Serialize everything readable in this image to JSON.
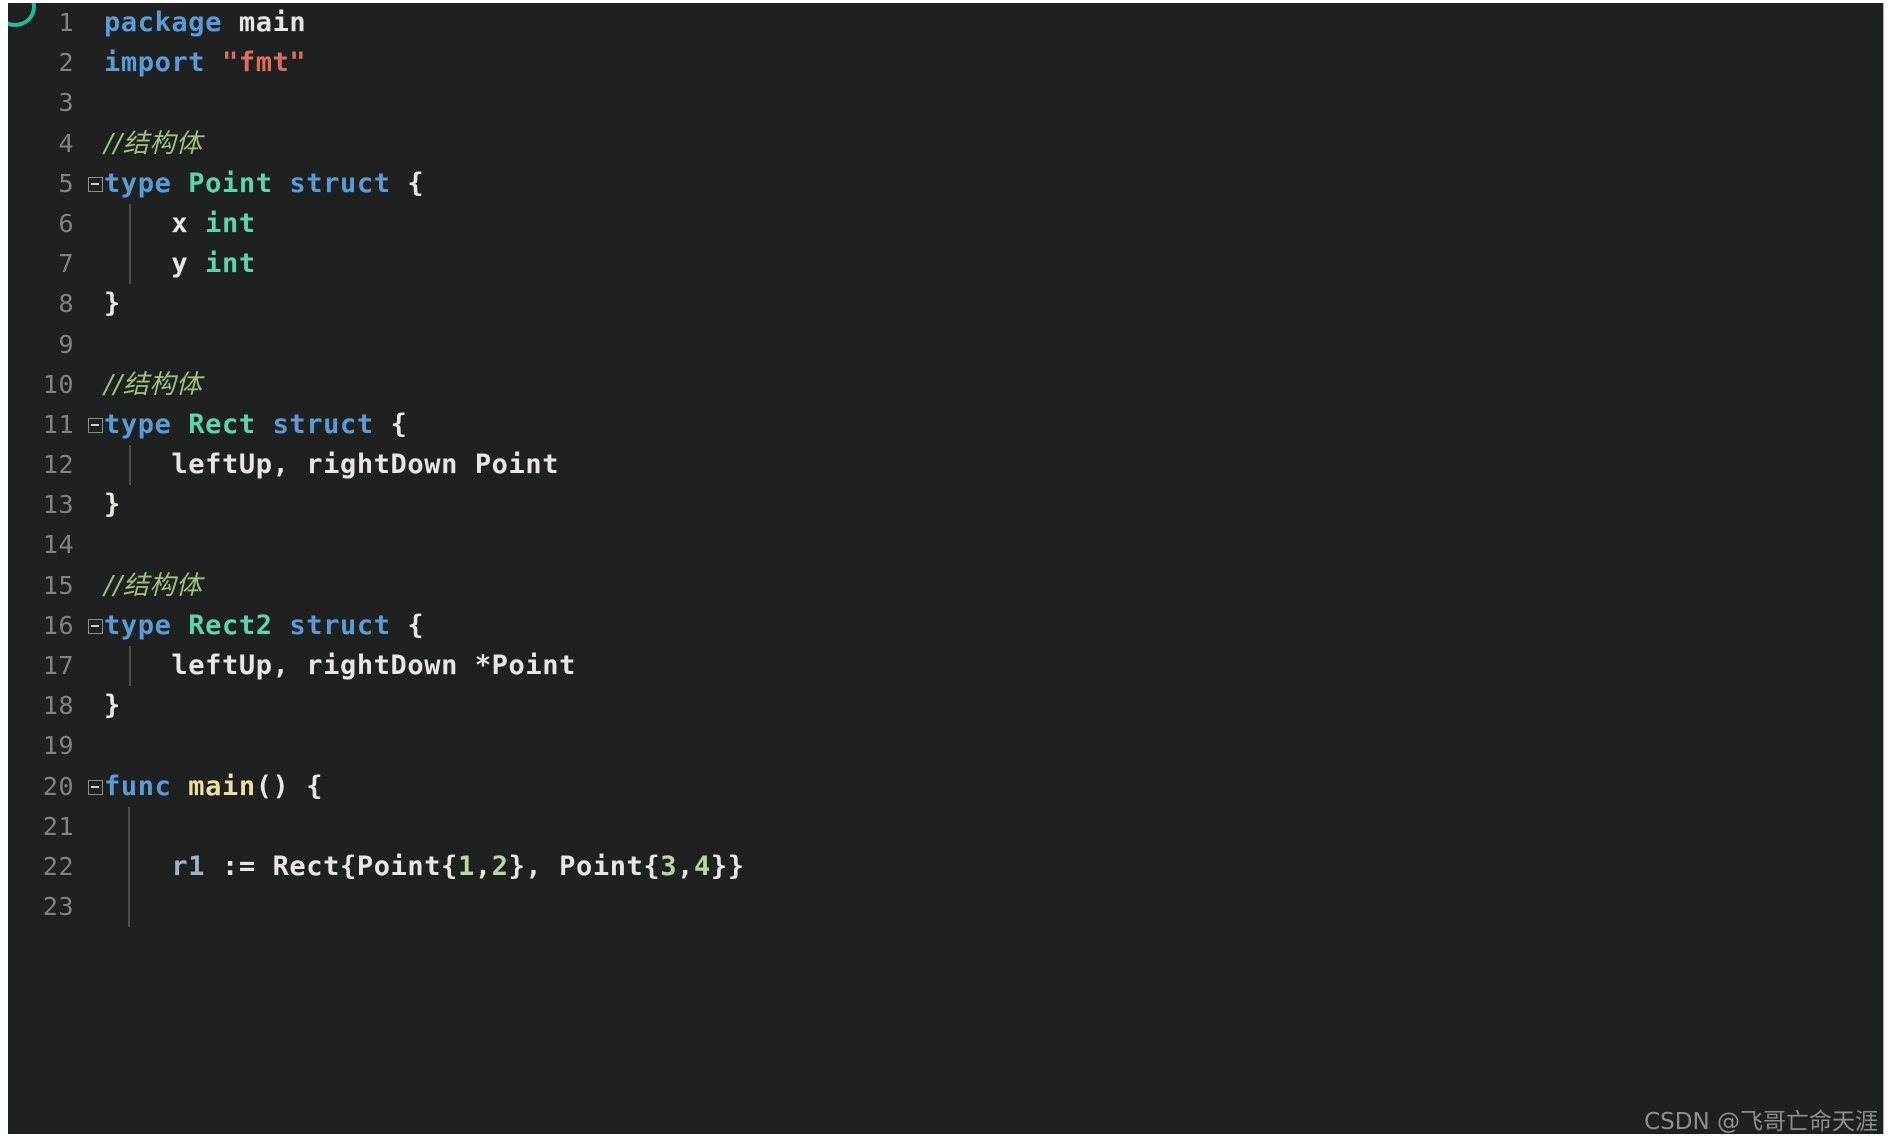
{
  "editor": {
    "language": "go",
    "background_color": "#1f2020",
    "gutter_text_color": "#7f8384",
    "fold_marker_glyph": "−",
    "lines": [
      {
        "number": "1",
        "folded": false,
        "indent_guide": false,
        "tokens": [
          {
            "text": "package",
            "type": "kw"
          },
          {
            "text": " ",
            "type": "plain"
          },
          {
            "text": "main",
            "type": "pkg"
          }
        ]
      },
      {
        "number": "2",
        "folded": false,
        "indent_guide": false,
        "tokens": [
          {
            "text": "import",
            "type": "kw"
          },
          {
            "text": " ",
            "type": "plain"
          },
          {
            "text": "\"fmt\"",
            "type": "str"
          }
        ]
      },
      {
        "number": "3",
        "folded": false,
        "indent_guide": false,
        "tokens": []
      },
      {
        "number": "4",
        "folded": false,
        "indent_guide": false,
        "tokens": [
          {
            "text": "//结构体",
            "type": "com"
          }
        ]
      },
      {
        "number": "5",
        "folded": true,
        "indent_guide": false,
        "tokens": [
          {
            "text": "type",
            "type": "kw"
          },
          {
            "text": " ",
            "type": "plain"
          },
          {
            "text": "Point",
            "type": "type"
          },
          {
            "text": " ",
            "type": "plain"
          },
          {
            "text": "struct",
            "type": "kw"
          },
          {
            "text": " ",
            "type": "plain"
          },
          {
            "text": "{",
            "type": "brace"
          }
        ]
      },
      {
        "number": "6",
        "folded": false,
        "indent_guide": true,
        "tokens": [
          {
            "text": "    x",
            "type": "plain"
          },
          {
            "text": " ",
            "type": "plain"
          },
          {
            "text": "int",
            "type": "type"
          }
        ]
      },
      {
        "number": "7",
        "folded": false,
        "indent_guide": true,
        "tokens": [
          {
            "text": "    y",
            "type": "plain"
          },
          {
            "text": " ",
            "type": "plain"
          },
          {
            "text": "int",
            "type": "type"
          }
        ]
      },
      {
        "number": "8",
        "folded": false,
        "indent_guide": false,
        "tokens": [
          {
            "text": "}",
            "type": "brace"
          }
        ]
      },
      {
        "number": "9",
        "folded": false,
        "indent_guide": false,
        "tokens": []
      },
      {
        "number": "10",
        "folded": false,
        "indent_guide": false,
        "tokens": [
          {
            "text": "//结构体",
            "type": "com"
          }
        ]
      },
      {
        "number": "11",
        "folded": true,
        "indent_guide": false,
        "tokens": [
          {
            "text": "type",
            "type": "kw"
          },
          {
            "text": " ",
            "type": "plain"
          },
          {
            "text": "Rect",
            "type": "type"
          },
          {
            "text": " ",
            "type": "plain"
          },
          {
            "text": "struct",
            "type": "kw"
          },
          {
            "text": " ",
            "type": "plain"
          },
          {
            "text": "{",
            "type": "brace"
          }
        ]
      },
      {
        "number": "12",
        "folded": false,
        "indent_guide": true,
        "tokens": [
          {
            "text": "    leftUp, rightDown Point",
            "type": "plain"
          }
        ]
      },
      {
        "number": "13",
        "folded": false,
        "indent_guide": false,
        "tokens": [
          {
            "text": "}",
            "type": "brace"
          }
        ]
      },
      {
        "number": "14",
        "folded": false,
        "indent_guide": false,
        "tokens": []
      },
      {
        "number": "15",
        "folded": false,
        "indent_guide": false,
        "tokens": [
          {
            "text": "//结构体",
            "type": "com"
          }
        ]
      },
      {
        "number": "16",
        "folded": true,
        "indent_guide": false,
        "tokens": [
          {
            "text": "type",
            "type": "kw"
          },
          {
            "text": " ",
            "type": "plain"
          },
          {
            "text": "Rect2",
            "type": "type"
          },
          {
            "text": " ",
            "type": "plain"
          },
          {
            "text": "struct",
            "type": "kw"
          },
          {
            "text": " ",
            "type": "plain"
          },
          {
            "text": "{",
            "type": "brace"
          }
        ]
      },
      {
        "number": "17",
        "folded": false,
        "indent_guide": true,
        "tokens": [
          {
            "text": "    leftUp, rightDown *Point",
            "type": "plain"
          }
        ]
      },
      {
        "number": "18",
        "folded": false,
        "indent_guide": false,
        "tokens": [
          {
            "text": "}",
            "type": "brace"
          }
        ]
      },
      {
        "number": "19",
        "folded": false,
        "indent_guide": false,
        "tokens": []
      },
      {
        "number": "20",
        "folded": true,
        "indent_guide": false,
        "tokens": [
          {
            "text": "func",
            "type": "kw"
          },
          {
            "text": " ",
            "type": "plain"
          },
          {
            "text": "main",
            "type": "fn"
          },
          {
            "text": "() {",
            "type": "plain"
          }
        ]
      },
      {
        "number": "21",
        "folded": false,
        "indent_guide": true,
        "tokens": []
      },
      {
        "number": "22",
        "folded": false,
        "indent_guide": true,
        "tokens": [
          {
            "text": "    ",
            "type": "plain"
          },
          {
            "text": "r1",
            "type": "var"
          },
          {
            "text": " := ",
            "type": "plain"
          },
          {
            "text": "Rect",
            "type": "plain"
          },
          {
            "text": "{",
            "type": "brace"
          },
          {
            "text": "Point",
            "type": "plain"
          },
          {
            "text": "{",
            "type": "brace"
          },
          {
            "text": "1",
            "type": "num"
          },
          {
            "text": ",",
            "type": "plain"
          },
          {
            "text": "2",
            "type": "num"
          },
          {
            "text": "}",
            "type": "brace"
          },
          {
            "text": ", ",
            "type": "plain"
          },
          {
            "text": "Point",
            "type": "plain"
          },
          {
            "text": "{",
            "type": "brace"
          },
          {
            "text": "3",
            "type": "num"
          },
          {
            "text": ",",
            "type": "plain"
          },
          {
            "text": "4",
            "type": "num"
          },
          {
            "text": "}}",
            "type": "brace"
          }
        ]
      },
      {
        "number": "23",
        "folded": false,
        "indent_guide": true,
        "tokens": []
      }
    ]
  },
  "watermark": {
    "text": "CSDN @飞哥亡命天涯"
  }
}
